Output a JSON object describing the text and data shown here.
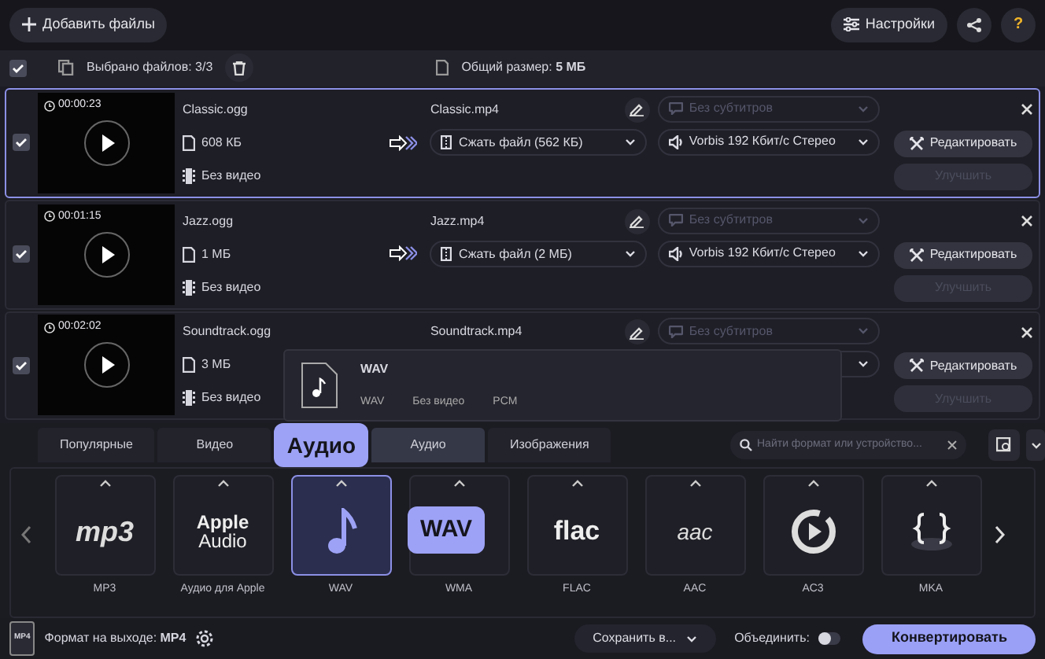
{
  "toolbar": {
    "add_button": "Добавить файлы",
    "settings_button": "Настройки",
    "help_button": "?"
  },
  "selection": {
    "checked": true,
    "selected_label": "Выбрано файлов: 3/3",
    "total_label": "Общий размер: **5 МБ**"
  },
  "files": [
    {
      "selected": true,
      "checked": true,
      "duration": "00:00:23",
      "name": "Classic.ogg",
      "size": "608 КБ",
      "video": "Без видео",
      "output_name": "Classic.mp4",
      "compress": "Сжать файл (562 КБ)",
      "subtitles": "Без субтитров",
      "subtitles_disabled": true,
      "audio": "Vorbis 192 Кбит/с Стерео",
      "edit_button": "Редактировать",
      "enhance_button": "Улучшить",
      "enhance_disabled": true
    },
    {
      "selected": false,
      "checked": true,
      "duration": "00:01:15",
      "name": "Jazz.ogg",
      "size": "1 МБ",
      "video": "Без видео",
      "output_name": "Jazz.mp4",
      "compress": "Сжать файл (2 МБ)",
      "subtitles": "Без субтитров",
      "subtitles_disabled": true,
      "audio": "Vorbis 192 Кбит/с Стерео",
      "edit_button": "Редактировать",
      "enhance_button": "Улучшить",
      "enhance_disabled": true
    },
    {
      "selected": false,
      "checked": true,
      "duration": "00:02:02",
      "name": "Soundtrack.ogg",
      "size": "3 МБ",
      "video": "Без видео",
      "output_name": "Soundtrack.mp4",
      "subtitles": "Без субтитров",
      "subtitles_disabled": true,
      "edit_button": "Редактировать",
      "enhance_button": "Улучшить",
      "enhance_disabled": true
    }
  ],
  "format_popup": {
    "title": "WAV",
    "details": [
      "WAV",
      "Без видео",
      "PCM"
    ]
  },
  "format_panel": {
    "tabs": [
      {
        "label": "Популярные",
        "selected": false
      },
      {
        "label": "Видео",
        "selected": false
      },
      {
        "label": "Аудио",
        "selected": true
      },
      {
        "label": "Изображения",
        "selected": false
      }
    ],
    "tab_callout": "Аудио",
    "search": {
      "placeholder": "Найти формат или устройство..."
    },
    "formats": [
      {
        "kind": "mp3",
        "label": "MP3",
        "logo_text": "mp3",
        "selected": false
      },
      {
        "kind": "apple",
        "label": "Аудио для Apple",
        "logo_lines": [
          "Apple",
          "Audio"
        ],
        "selected": false
      },
      {
        "kind": "note",
        "label": "WAV",
        "selected": true
      },
      {
        "kind": "blank",
        "label": "WMA",
        "selected": false
      },
      {
        "kind": "flac",
        "label": "FLAC",
        "logo_text": "flac",
        "selected": false
      },
      {
        "kind": "aac",
        "label": "AAC",
        "logo_text": "aac",
        "selected": false
      },
      {
        "kind": "play",
        "label": "AC3",
        "selected": false
      },
      {
        "kind": "braces",
        "label": "MKA",
        "selected": false
      }
    ],
    "format_callout": "WAV"
  },
  "bottom_bar": {
    "file_badge": "MP4",
    "output_format": "Формат на выходе: **MP4**",
    "save_button": "Сохранить в...",
    "merge_label": "Объединить:",
    "merge_on": false,
    "convert_button": "Конвертировать"
  }
}
